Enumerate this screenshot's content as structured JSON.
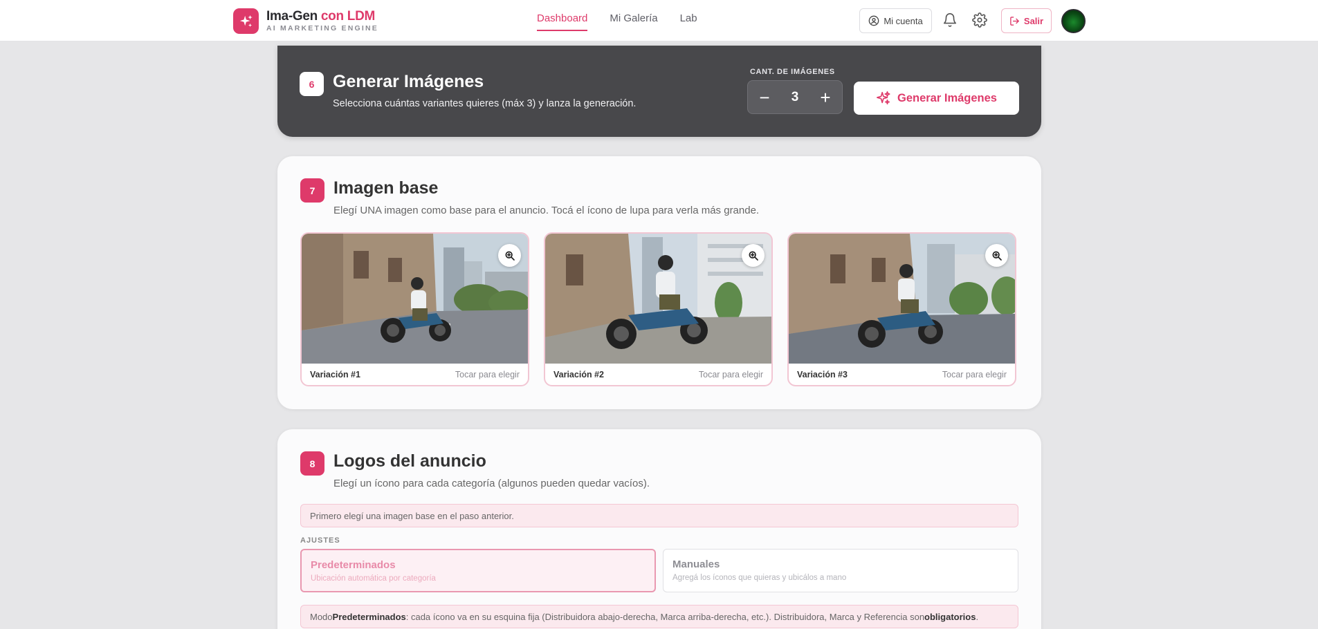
{
  "header": {
    "brand_main": "Ima-Gen ",
    "brand_accent": "con LDM",
    "brand_sub": "AI MARKETING ENGINE",
    "nav": [
      {
        "label": "Dashboard",
        "active": true
      },
      {
        "label": "Mi Galería",
        "active": false
      },
      {
        "label": "Lab",
        "active": false
      }
    ],
    "account_label": "Mi cuenta",
    "logout_label": "Salir",
    "accent_color": "#de3a6a"
  },
  "generate": {
    "step": "6",
    "title": "Generar Imágenes",
    "subtitle": "Selecciona cuántas variantes quieres (máx 3) y lanza la generación.",
    "qty_label": "CANT. DE IMÁGENES",
    "qty_minus": "−",
    "qty_value": "3",
    "qty_plus": "+",
    "button_label": "Generar Imágenes"
  },
  "base_image": {
    "step": "7",
    "title": "Imagen base",
    "subtitle": "Elegí UNA imagen como base para el anuncio. Tocá el ícono de lupa para verla más grande.",
    "variations": [
      {
        "name": "Variación #1",
        "hint": "Tocar para elegir"
      },
      {
        "name": "Variación #2",
        "hint": "Tocar para elegir"
      },
      {
        "name": "Variación #3",
        "hint": "Tocar para elegir"
      }
    ]
  },
  "logos": {
    "step": "8",
    "title": "Logos del anuncio",
    "subtitle": "Elegí un ícono para cada categoría (algunos pueden quedar vacíos).",
    "notice_first": "Primero elegí una imagen base en el paso anterior.",
    "adjust_label": "AJUSTES",
    "modes": [
      {
        "title": "Predeterminados",
        "desc": "Ubicación automática por categoría"
      },
      {
        "title": "Manuales",
        "desc": "Agregá los íconos que quieras y ubicálos a mano"
      }
    ],
    "mode_notice": {
      "prefix": "Modo ",
      "mode_name": "Predeterminados",
      "middle": ": cada ícono va en su esquina fija (Distribuidora abajo-derecha, Marca arriba-derecha, etc.). Distribuidora, Marca y Referencia son ",
      "emphasis": "obligatorios",
      "suffix": "."
    }
  }
}
